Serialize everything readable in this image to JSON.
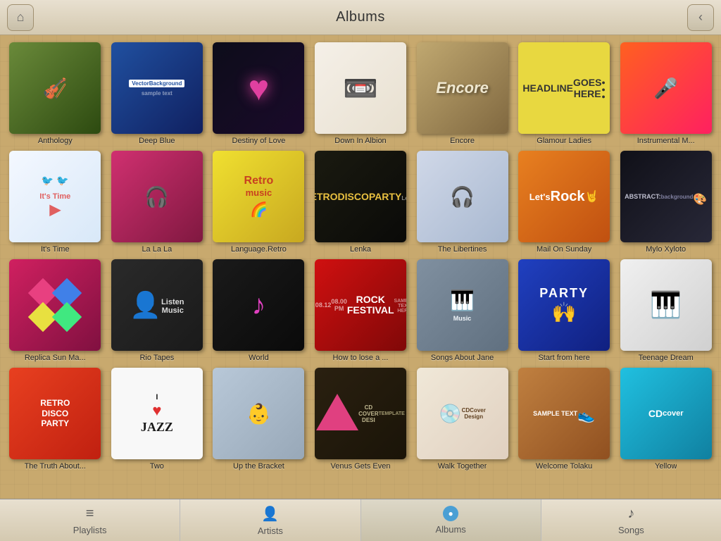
{
  "header": {
    "title": "Albums",
    "home_button_label": "⌂",
    "back_button_label": "‹"
  },
  "albums": [
    {
      "id": "anthology",
      "title": "Anthology",
      "cover_type": "violin"
    },
    {
      "id": "deep-blue",
      "title": "Deep Blue",
      "cover_type": "vector"
    },
    {
      "id": "destiny",
      "title": "Destiny of Love",
      "cover_type": "heart"
    },
    {
      "id": "down",
      "title": "Down In Albion",
      "cover_type": "cassette"
    },
    {
      "id": "encore",
      "title": "Encore",
      "cover_type": "encore"
    },
    {
      "id": "glamour",
      "title": "Glamour Ladies",
      "cover_type": "headline"
    },
    {
      "id": "instrumental",
      "title": "Instrumental M...",
      "cover_type": "concert"
    },
    {
      "id": "itstime",
      "title": "It's Time",
      "cover_type": "birds"
    },
    {
      "id": "lalala",
      "title": "La La La",
      "cover_type": "dj"
    },
    {
      "id": "language",
      "title": "Language.Retro",
      "cover_type": "retro"
    },
    {
      "id": "lenka",
      "title": "Lenka",
      "cover_type": "disco"
    },
    {
      "id": "libertines",
      "title": "The Libertines",
      "cover_type": "xray"
    },
    {
      "id": "mailsunday",
      "title": "Mail On Sunday",
      "cover_type": "letsrock"
    },
    {
      "id": "mylo",
      "title": "Mylo Xyloto",
      "cover_type": "abstract"
    },
    {
      "id": "replica",
      "title": "Replica Sun Ma...",
      "cover_type": "diamond"
    },
    {
      "id": "rio",
      "title": "Rio Tapes",
      "cover_type": "listen"
    },
    {
      "id": "world",
      "title": "World",
      "cover_type": "musicnote"
    },
    {
      "id": "rock",
      "title": "How to lose a ...",
      "cover_type": "rockfest"
    },
    {
      "id": "songs",
      "title": "Songs About Jane",
      "cover_type": "piano"
    },
    {
      "id": "start",
      "title": "Start from here",
      "cover_type": "party"
    },
    {
      "id": "teenage",
      "title": "Teenage Dream",
      "cover_type": "keys"
    },
    {
      "id": "truth",
      "title": "The Truth About...",
      "cover_type": "retro2"
    },
    {
      "id": "two",
      "title": "Two",
      "cover_type": "jazz"
    },
    {
      "id": "bracket",
      "title": "Up the Bracket",
      "cover_type": "kid"
    },
    {
      "id": "venus",
      "title": "Venus Gets Even",
      "cover_type": "triangle"
    },
    {
      "id": "walk",
      "title": "Walk Together",
      "cover_type": "cddesign"
    },
    {
      "id": "welcome",
      "title": "Welcome Tolaku",
      "cover_type": "sample"
    },
    {
      "id": "yellow",
      "title": "Yellow",
      "cover_type": "cdblue"
    }
  ],
  "tabs": [
    {
      "id": "playlists",
      "label": "Playlists",
      "icon": "≡",
      "active": false
    },
    {
      "id": "artists",
      "label": "Artists",
      "icon": "👤",
      "active": false
    },
    {
      "id": "albums",
      "label": "Albums",
      "icon": "●",
      "active": true
    },
    {
      "id": "songs",
      "label": "Songs",
      "icon": "♪",
      "active": false
    }
  ]
}
